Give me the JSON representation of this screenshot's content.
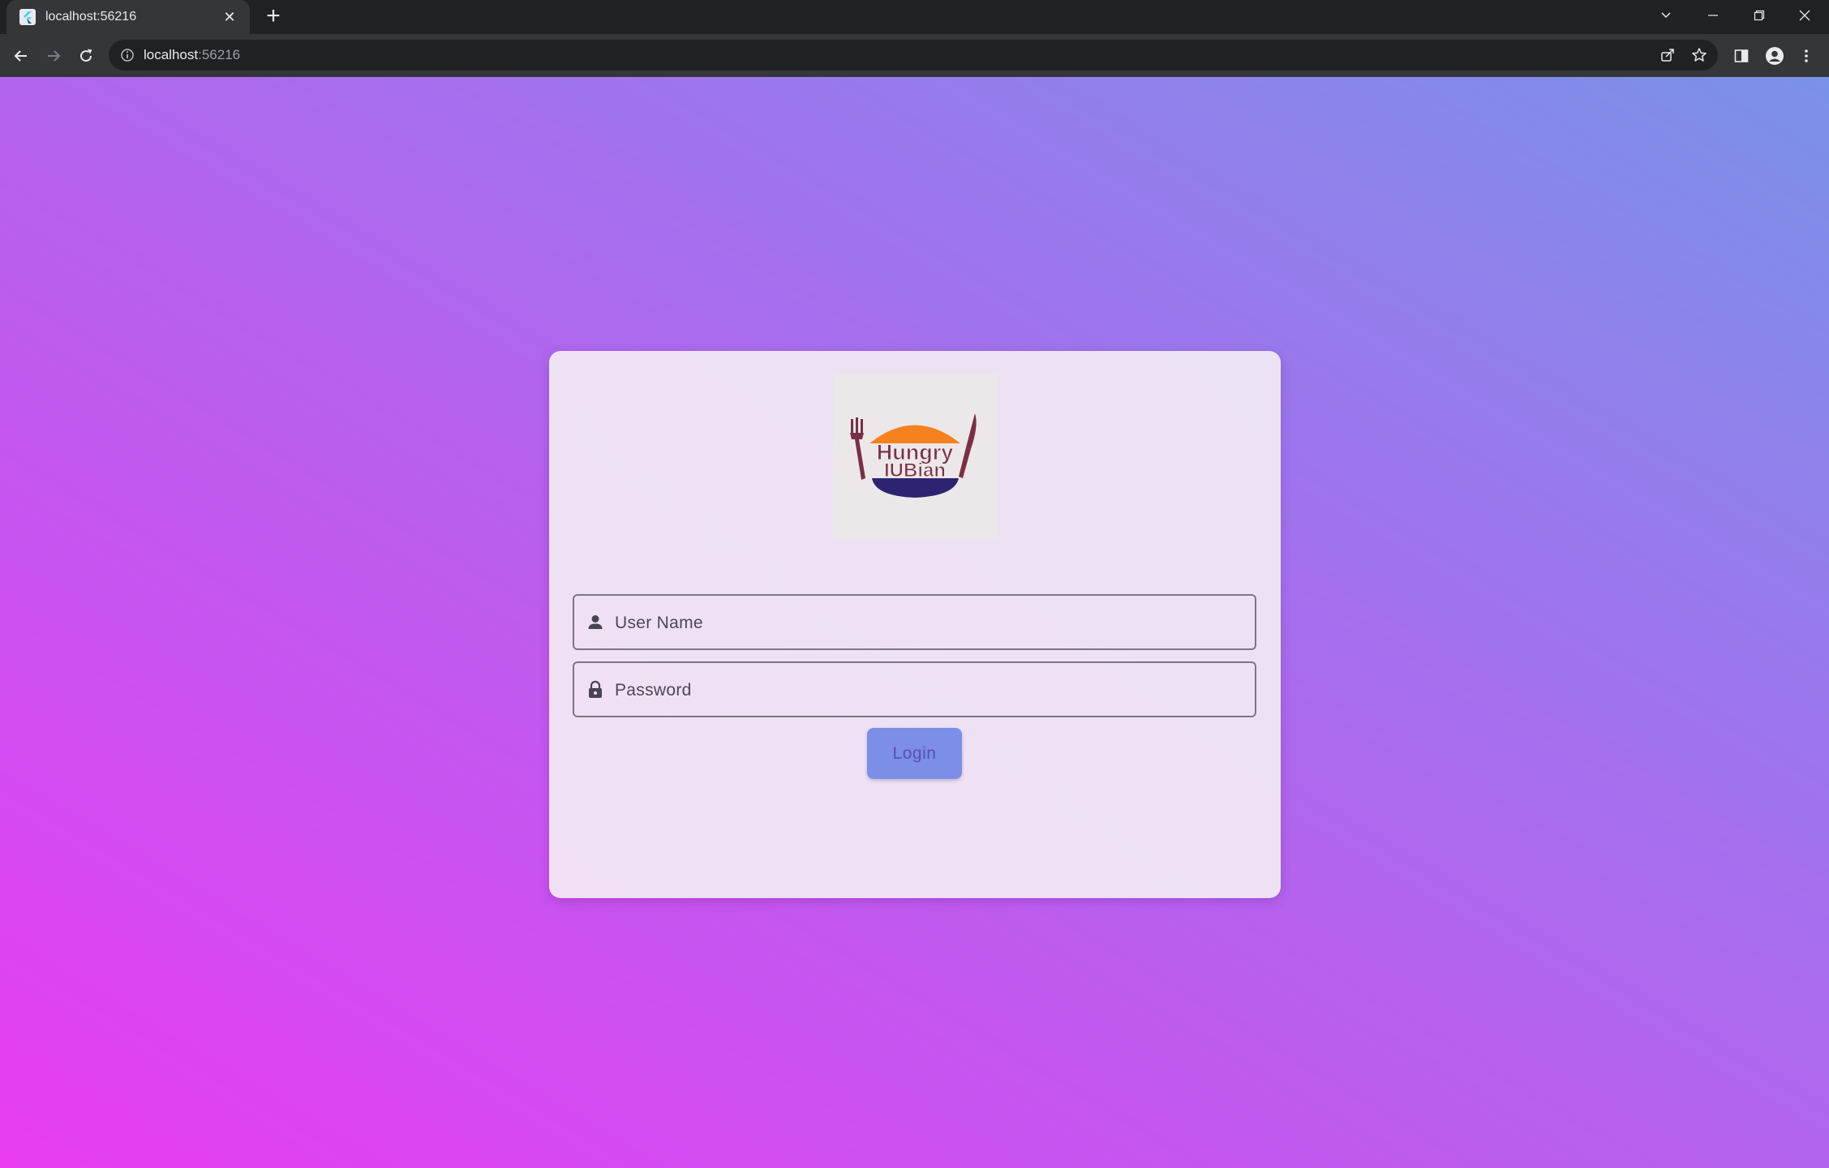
{
  "browser": {
    "tab_title": "localhost:56216",
    "url_host": "localhost",
    "url_port": ":56216"
  },
  "login": {
    "logo_text_line1": "Hungry",
    "logo_text_line2": "IUBian",
    "username_placeholder": "User Name",
    "password_placeholder": "Password",
    "login_label": "Login"
  },
  "colors": {
    "gradient_start": "#e83cf0",
    "gradient_end": "#7a92e8",
    "card": "#efe1f5",
    "button": "#7b8fe6",
    "logo_bun_top": "#f5821f",
    "logo_bun_bottom": "#2c2470",
    "logo_text": "#7a2f45"
  },
  "icons": {
    "username": "person-icon",
    "password": "lock-icon"
  }
}
